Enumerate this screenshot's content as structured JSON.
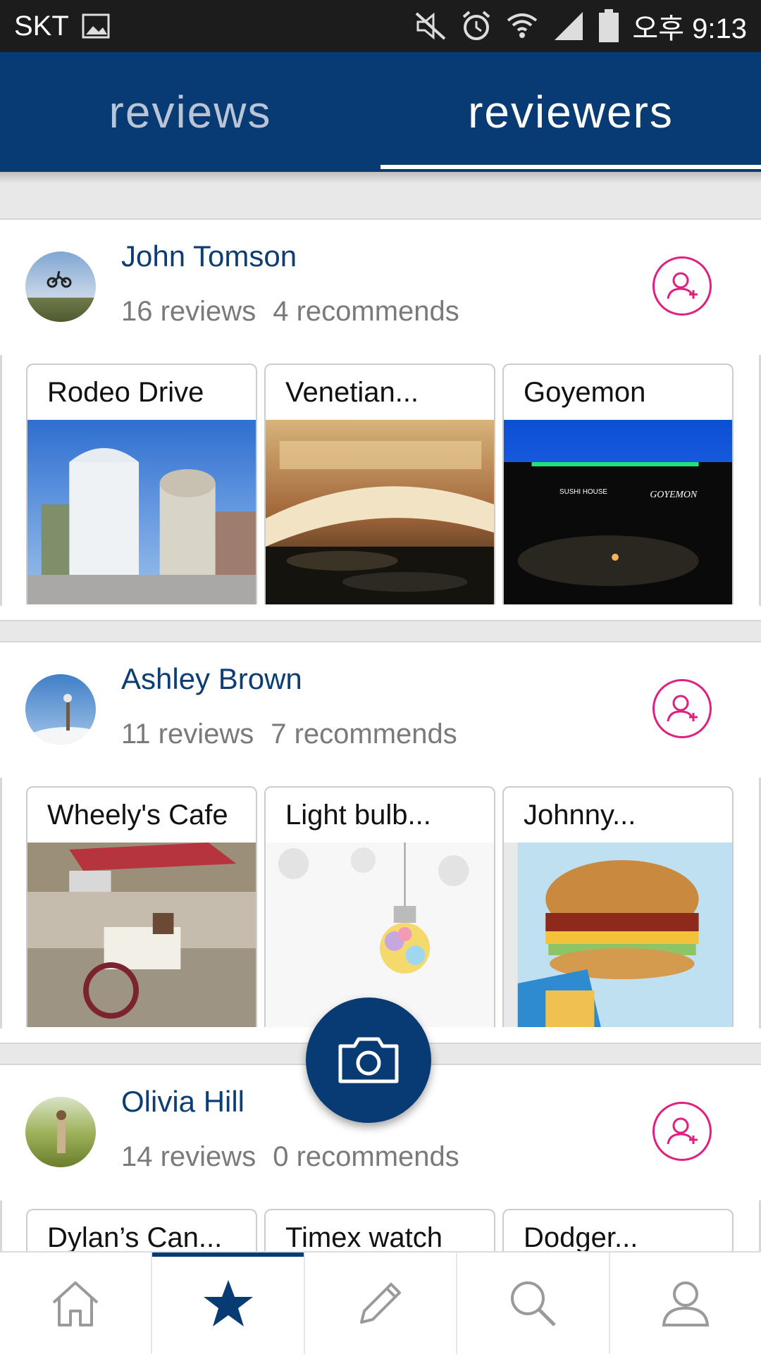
{
  "status_bar": {
    "carrier": "SKT",
    "clock": "오후 9:13",
    "icons": [
      "image-icon",
      "mute-icon",
      "alarm-icon",
      "wifi-icon",
      "signal-icon",
      "battery-icon"
    ]
  },
  "tabs": [
    {
      "label": "reviews",
      "active": false
    },
    {
      "label": "reviewers",
      "active": true
    }
  ],
  "colors": {
    "primary": "#083a73",
    "accent": "#e0207f",
    "text_muted": "#7a7a7a"
  },
  "reviewers": [
    {
      "name": "John Tomson",
      "reviews": "16 reviews",
      "recommends": "4 recommends",
      "places": [
        {
          "title": "Rodeo Drive"
        },
        {
          "title": "Venetian..."
        },
        {
          "title": "Goyemon",
          "sign_text": "GOYEMON",
          "sign_sub": "SUSHI HOUSE"
        }
      ]
    },
    {
      "name": "Ashley Brown",
      "reviews": "11 reviews",
      "recommends": "7 recommends",
      "places": [
        {
          "title": "Wheely's Cafe"
        },
        {
          "title": "Light bulb..."
        },
        {
          "title": "Johnny..."
        }
      ]
    },
    {
      "name": "Olivia Hill",
      "reviews": "14 reviews",
      "recommends": "0 recommends",
      "places": [
        {
          "title": "Dylan’s Can..."
        },
        {
          "title": "Timex watch"
        },
        {
          "title": "Dodger..."
        }
      ]
    }
  ],
  "bottom_nav": [
    {
      "icon": "home-icon",
      "active": false
    },
    {
      "icon": "star-icon",
      "active": true
    },
    {
      "icon": "pencil-icon",
      "active": false
    },
    {
      "icon": "search-icon",
      "active": false
    },
    {
      "icon": "profile-icon",
      "active": false
    }
  ],
  "fab": {
    "icon": "camera-icon"
  }
}
